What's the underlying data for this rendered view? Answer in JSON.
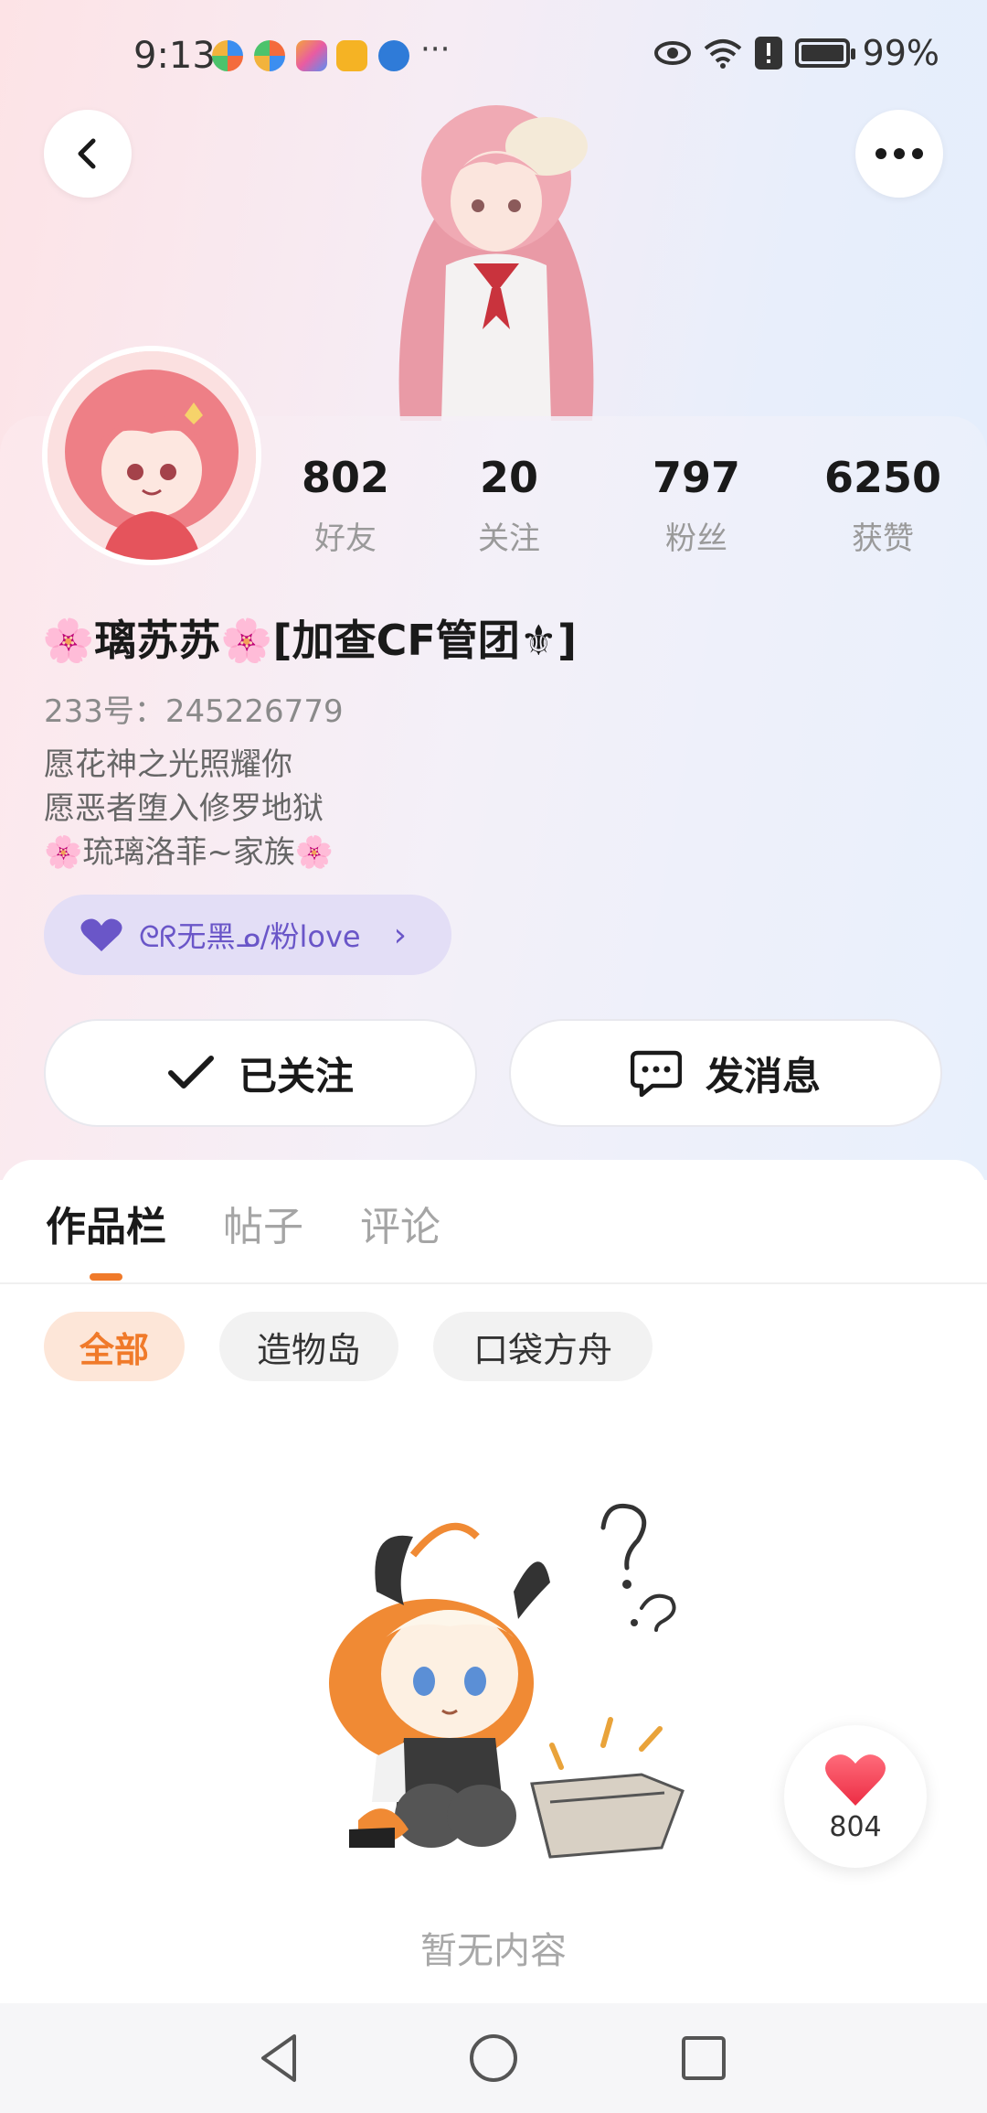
{
  "status_bar": {
    "time": "9:13",
    "more": "···",
    "battery": "99%",
    "notification_colors": [
      "#3c8ef0",
      "#f46b3c",
      "#f2b33c",
      "#f5b324",
      "#2f7bd8"
    ]
  },
  "header": {
    "back_icon": "chevron-left-icon",
    "more_icon": "more-horizontal-icon"
  },
  "profile": {
    "stats": [
      {
        "value": "802",
        "label": "好友"
      },
      {
        "value": "20",
        "label": "关注"
      },
      {
        "value": "797",
        "label": "粉丝"
      },
      {
        "value": "6250",
        "label": "获赞"
      }
    ],
    "username": "🌸璃苏苏🌸[加查CF管团⚜]",
    "uid": "233号：245226779",
    "bio": [
      "愿花神之光照耀你",
      "愿恶者堕入修罗地狱",
      "🌸琉璃洛菲~家族🌸"
    ],
    "family_chip": {
      "text": "ᘓᖇ无黑ᓄ/粉love",
      "icon": "purple-heart-icon",
      "arrow": "›"
    },
    "follow_button": "已关注",
    "message_button": "发消息"
  },
  "tabs": [
    {
      "label": "作品栏",
      "active": true
    },
    {
      "label": "帖子",
      "active": false
    },
    {
      "label": "评论",
      "active": false
    }
  ],
  "filters": [
    {
      "label": "全部",
      "active": true
    },
    {
      "label": "造物岛",
      "active": false
    },
    {
      "label": "口袋方舟",
      "active": false
    }
  ],
  "empty_state": {
    "text": "暂无内容"
  },
  "like_button": {
    "count": "804"
  },
  "colors": {
    "accent": "#f07a2a",
    "family_purple": "#6a56c8"
  }
}
